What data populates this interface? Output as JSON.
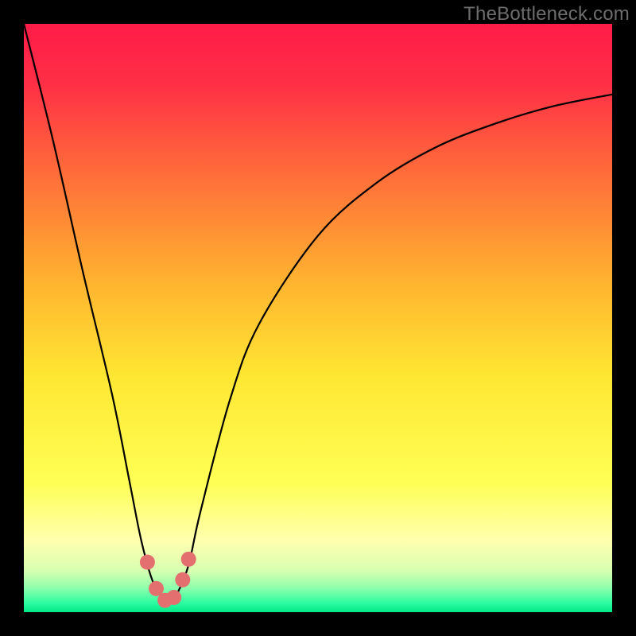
{
  "watermark": "TheBottleneck.com",
  "chart_data": {
    "type": "line",
    "title": "",
    "xlabel": "",
    "ylabel": "",
    "xlim": [
      0,
      100
    ],
    "ylim": [
      0,
      100
    ],
    "grid": false,
    "series": [
      {
        "name": "bottleneck-curve",
        "x": [
          0,
          5,
          10,
          15,
          18,
          20,
          22,
          24,
          25,
          26,
          28,
          30,
          35,
          40,
          50,
          60,
          70,
          80,
          90,
          100
        ],
        "y": [
          100,
          80,
          58,
          37,
          22,
          12,
          5,
          2,
          2,
          3,
          8,
          17,
          36,
          49,
          64,
          73,
          79,
          83,
          86,
          88
        ]
      }
    ],
    "markers": {
      "name": "highlight-points",
      "color": "#e36f6f",
      "x": [
        21.0,
        22.5,
        24.0,
        25.5,
        27.0,
        28.0
      ],
      "y": [
        8.5,
        4.0,
        2.0,
        2.5,
        5.5,
        9.0
      ]
    },
    "background_gradient": {
      "stops": [
        {
          "offset": 0.0,
          "color": "#ff1c48"
        },
        {
          "offset": 0.1,
          "color": "#ff2e46"
        },
        {
          "offset": 0.25,
          "color": "#ff6b3a"
        },
        {
          "offset": 0.45,
          "color": "#ffb72f"
        },
        {
          "offset": 0.6,
          "color": "#ffe733"
        },
        {
          "offset": 0.78,
          "color": "#ffff55"
        },
        {
          "offset": 0.88,
          "color": "#ffffb0"
        },
        {
          "offset": 0.93,
          "color": "#d7ffb0"
        },
        {
          "offset": 0.96,
          "color": "#8bffac"
        },
        {
          "offset": 0.985,
          "color": "#2bfca0"
        },
        {
          "offset": 1.0,
          "color": "#00e887"
        }
      ]
    }
  }
}
